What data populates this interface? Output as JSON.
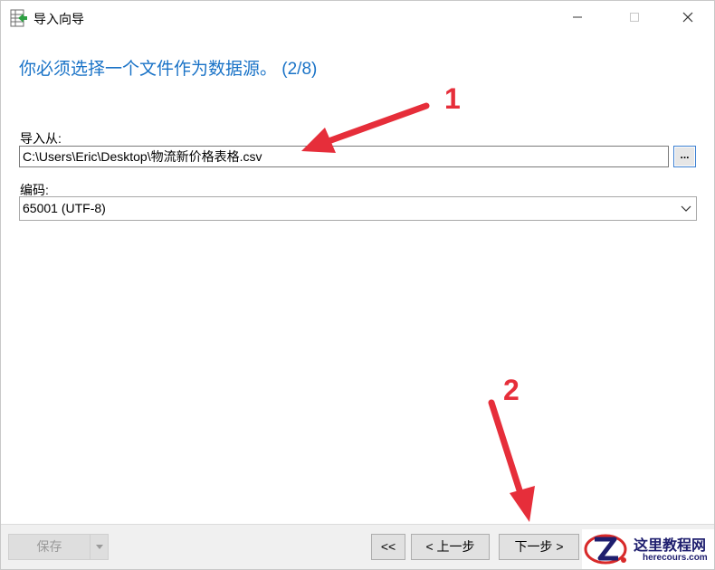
{
  "window": {
    "title": "导入向导",
    "icon": "table-import-icon"
  },
  "wizard": {
    "heading": "你必须选择一个文件作为数据源。 (2/8)"
  },
  "form": {
    "import_from_label": "导入从:",
    "import_path": "C:\\Users\\Eric\\Desktop\\物流新价格表格.csv",
    "browse_label": "...",
    "encoding_label": "编码:",
    "encoding_value": "65001 (UTF-8)"
  },
  "footer": {
    "save_label": "保存",
    "first_label": "<<",
    "prev_label": "< 上一步",
    "next_label": "下一步 >"
  },
  "annotations": {
    "marker_1": "1",
    "marker_2": "2",
    "color": "#e62e3a"
  },
  "watermark": {
    "title": "这里教程网",
    "url": "herecours.com"
  },
  "colors": {
    "heading": "#1a73c7",
    "browse_border": "#3c7fd1"
  }
}
